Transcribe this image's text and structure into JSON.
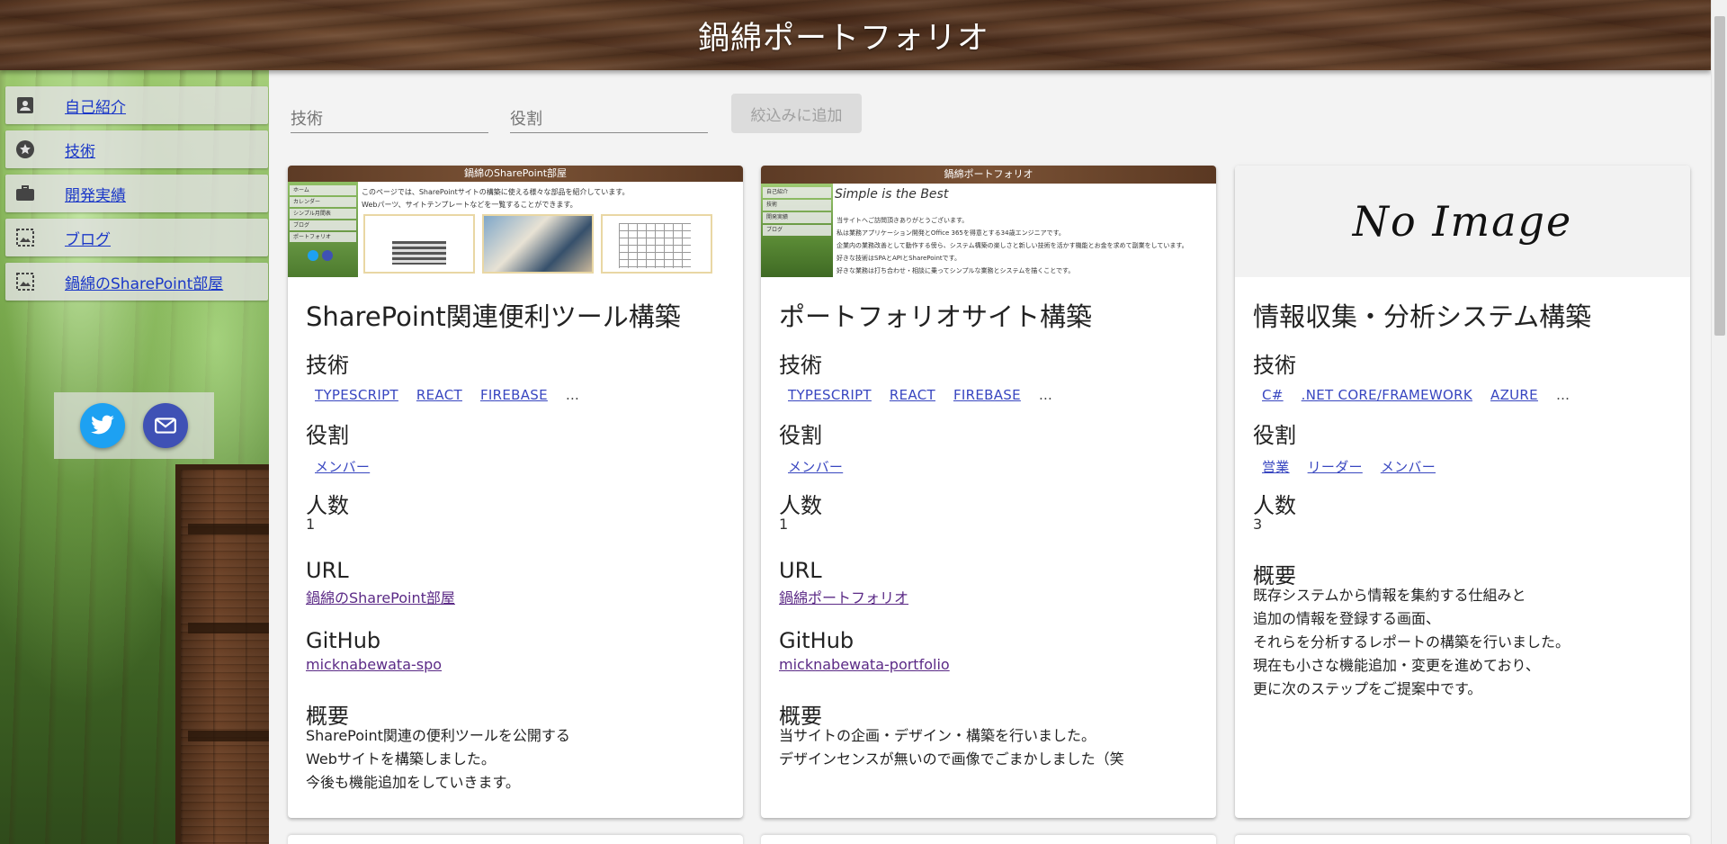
{
  "header": {
    "title": "鍋綿ポートフォリオ"
  },
  "sidebar": {
    "items": [
      {
        "label": "自己紹介",
        "icon": "account-box-icon"
      },
      {
        "label": "技術",
        "icon": "stars-icon"
      },
      {
        "label": "開発実績",
        "icon": "work-icon"
      },
      {
        "label": "ブログ",
        "icon": "image-icon"
      },
      {
        "label": "鍋綿のSharePoint部屋",
        "icon": "image-icon"
      }
    ],
    "social": {
      "twitter": "twitter-icon",
      "mail": "mail-icon"
    }
  },
  "filters": {
    "tech_placeholder": "技術",
    "role_placeholder": "役割",
    "add_button": "絞込みに追加"
  },
  "labels": {
    "tech": "技術",
    "role": "役割",
    "people": "人数",
    "url": "URL",
    "github": "GitHub",
    "summary": "概要",
    "more": "…"
  },
  "cards": [
    {
      "title": "SharePoint関連便利ツール構築",
      "tech": [
        "TYPESCRIPT",
        "REACT",
        "FIREBASE"
      ],
      "roles": [
        "メンバー"
      ],
      "people": "1",
      "url": "鍋綿のSharePoint部屋",
      "github": "micknabewata-spo",
      "summary": [
        "SharePoint関連の便利ツールを公開する",
        "Webサイトを構築しました。",
        "今後も機能追加をしていきます。"
      ],
      "thumb": {
        "header": "鍋綿のSharePoint部屋",
        "nav": [
          "ホーム",
          "カレンダー",
          "シンプル月間表",
          "ブログ",
          "ポートフォリオ"
        ],
        "lines": [
          "このページでは、SharePointサイトの構築に使える様々な部品を紹介しています。",
          "Webパーツ、サイトテンプレートなどを一覧することができます。"
        ]
      }
    },
    {
      "title": "ポートフォリオサイト構築",
      "tech": [
        "TYPESCRIPT",
        "REACT",
        "FIREBASE"
      ],
      "roles": [
        "メンバー"
      ],
      "people": "1",
      "url": "鍋綿ポートフォリオ",
      "github": "micknabewata-portfolio",
      "summary": [
        "当サイトの企画・デザイン・構築を行いました。",
        "デザインセンスが無いので画像でごまかしました（笑"
      ],
      "thumb": {
        "header": "鍋綿ポートフォリオ",
        "heading": "Simple is the Best",
        "nav": [
          "自己紹介",
          "技術",
          "開発実績",
          "ブログ"
        ],
        "lines": [
          "当サイトへご訪問頂きありがとうございます。",
          "私は業務アプリケーション開発とOffice 365を得意とする34歳エンジニアです。",
          "企業内の業務改善として動作する傍ら、システム構築の楽しさと新しい技術を活かす機能とお金を求めて副業をしています。",
          "好きな技術はSPAとAPIとSharePointです。",
          "好きな業務は打ち合わせ・相談に乗ってシンプルな業務とシステムを描くことです。"
        ]
      }
    },
    {
      "title": "情報収集・分析システム構築",
      "tech": [
        "C#",
        ".NET CORE/FRAMEWORK",
        "AZURE"
      ],
      "roles": [
        "営業",
        "リーダー",
        "メンバー"
      ],
      "people": "3",
      "summary": [
        "既存システムから情報を集約する仕組みと",
        "追加の情報を登録する画面、",
        "それらを分析するレポートの構築を行いました。",
        "現在も小さな機能追加・変更を進めており、",
        "更に次のステップをご提案中です。"
      ],
      "thumb": {
        "text": "No Image"
      }
    }
  ]
}
